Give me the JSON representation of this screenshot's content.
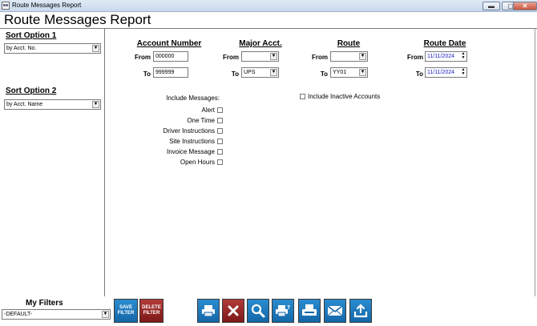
{
  "window": {
    "title": "Route Messages Report",
    "app_icon_text": "sw",
    "minimize_glyph": "▬",
    "restore_glyph": "▢",
    "close_glyph": "✕"
  },
  "page_title": "Route Messages Report",
  "sidebar": {
    "sort1": {
      "heading": "Sort Option 1",
      "value": "by Acct. No."
    },
    "sort2": {
      "heading": "Sort Option 2",
      "value": "by Acct. Name"
    }
  },
  "criteria": {
    "account_number": {
      "heading": "Account Number",
      "from_label": "From",
      "to_label": "To",
      "from_value": "000000",
      "to_value": "999999"
    },
    "major_acct": {
      "heading": "Major Acct.",
      "from_label": "From",
      "to_label": "To",
      "from_value": "",
      "to_value": "UPS"
    },
    "route": {
      "heading": "Route",
      "from_label": "From",
      "to_label": "To",
      "from_value": "",
      "to_value": "YY01"
    },
    "route_date": {
      "heading": "Route Date",
      "from_label": "From",
      "to_label": "To",
      "from_value": "11/11/2024",
      "to_value": "11/11/2024"
    }
  },
  "include_messages": {
    "heading": "Include Messages:",
    "items": [
      "Alert",
      "One Time",
      "Driver Instructions",
      "Site Instructions",
      "Invoice Message",
      "Open Hours"
    ]
  },
  "include_inactive_label": "Include Inactive Accounts",
  "filters": {
    "heading": "My Filters",
    "value": "-DEFAULT-",
    "save_label": "SAVE FILTER",
    "delete_label": "DELETE FILTER"
  },
  "toolbar_icons": [
    "print-icon",
    "cancel-icon",
    "search-icon",
    "print-preview-icon",
    "fax-icon",
    "email-icon",
    "export-icon"
  ],
  "colors": {
    "toolbar_blue": "#1e7cc0",
    "toolbar_red": "#9a2626",
    "date_text": "#1b1bc7"
  }
}
